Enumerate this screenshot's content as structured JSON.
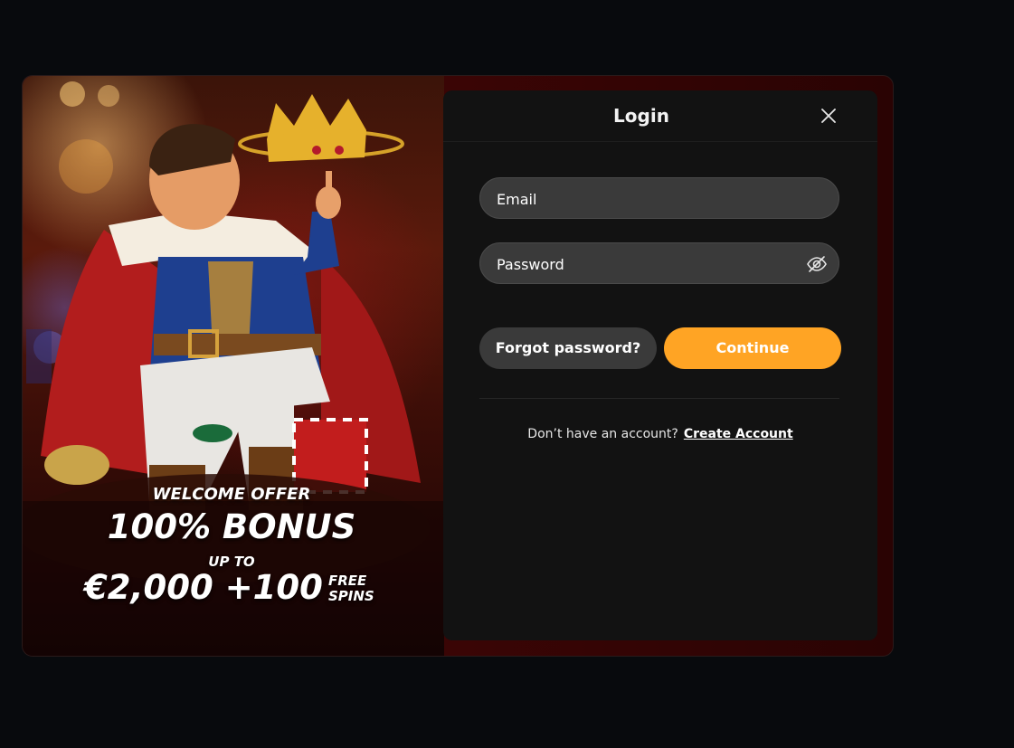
{
  "promo": {
    "welcome": "WELCOME OFFER",
    "bonus": "100% BONUS",
    "up_to": "UP TO",
    "amount": "€2,000 +100",
    "spins_line1": "FREE",
    "spins_line2": "SPINS"
  },
  "login": {
    "title": "Login",
    "email_placeholder": "Email",
    "password_placeholder": "Password",
    "forgot_label": "Forgot password?",
    "continue_label": "Continue",
    "no_account_text": "Don’t have an account?",
    "create_account_label": "Create Account"
  },
  "icons": {
    "close": "close-icon",
    "eye": "eye-slash-icon"
  },
  "colors": {
    "page_bg": "#080a0d",
    "panel_bg": "#121212",
    "field_bg": "#3a3a3a",
    "accent": "#ffa424"
  }
}
